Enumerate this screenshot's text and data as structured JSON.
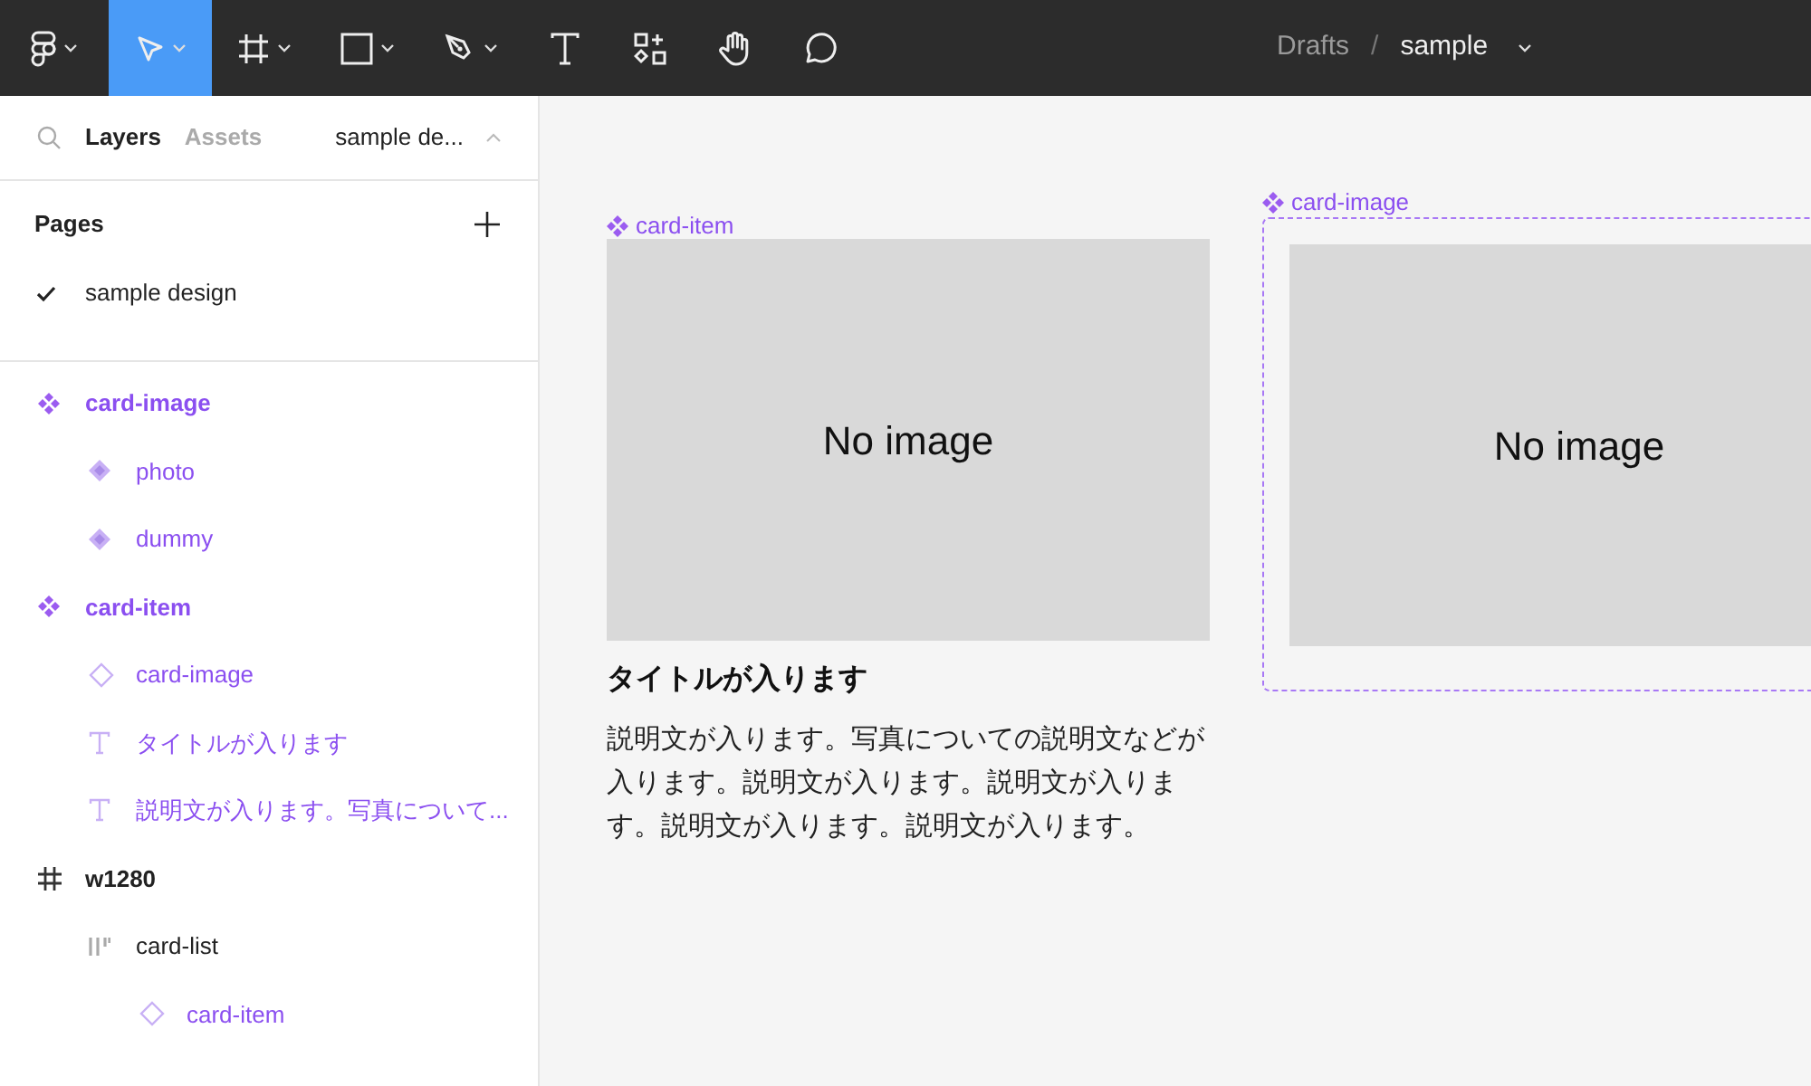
{
  "toolbar": {
    "tools": [
      {
        "kind": "logo",
        "caret": true,
        "selected": false
      },
      {
        "kind": "move",
        "caret": true,
        "selected": true
      },
      {
        "kind": "frame",
        "caret": true,
        "selected": false
      },
      {
        "kind": "shape",
        "caret": true,
        "selected": false
      },
      {
        "kind": "pen",
        "caret": true,
        "selected": false
      },
      {
        "kind": "text",
        "caret": false,
        "selected": false
      },
      {
        "kind": "resources",
        "caret": false,
        "selected": false
      },
      {
        "kind": "hand",
        "caret": false,
        "selected": false
      },
      {
        "kind": "comment",
        "caret": false,
        "selected": false
      }
    ],
    "breadcrumb": {
      "folder": "Drafts",
      "separator": "/",
      "file": "sample"
    }
  },
  "sidebar": {
    "tabs": [
      {
        "label": "Layers",
        "selected": true
      },
      {
        "label": "Assets",
        "selected": false
      }
    ],
    "page_switcher": "sample de...",
    "pages": {
      "title": "Pages",
      "items": [
        {
          "label": "sample design",
          "selected": true
        }
      ]
    },
    "layers": [
      {
        "kind": "component",
        "name": "card-image",
        "children": [
          {
            "kind": "variant",
            "name": "photo"
          },
          {
            "kind": "variant",
            "name": "dummy"
          }
        ]
      },
      {
        "kind": "component",
        "name": "card-item",
        "children": [
          {
            "kind": "instance",
            "name": "card-image"
          },
          {
            "kind": "text",
            "name": "タイトルが入ります"
          },
          {
            "kind": "text",
            "name": "説明文が入ります。写真について..."
          }
        ]
      },
      {
        "kind": "frame",
        "name": "w1280",
        "children": [
          {
            "kind": "autolayout",
            "name": "card-list",
            "children": [
              {
                "kind": "instance",
                "name": "card-item"
              }
            ]
          }
        ]
      }
    ]
  },
  "canvas": {
    "card_item": {
      "label": "card-item",
      "image_text": "No image",
      "title": "タイトルが入ります",
      "description": "説明文が入ります。写真についての説明文などが入ります。説明文が入ります。説明文が入ります。説明文が入ります。説明文が入ります。"
    },
    "card_image": {
      "label": "card-image",
      "image_text": "No image"
    }
  }
}
